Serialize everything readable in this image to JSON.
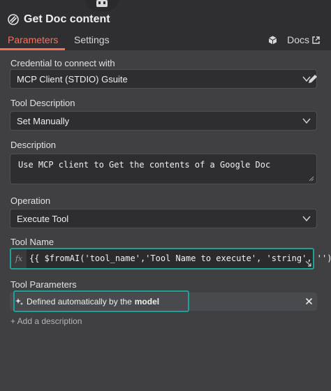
{
  "header": {
    "title": "Get Doc content"
  },
  "tabs": {
    "parameters": "Parameters",
    "settings": "Settings",
    "docs": "Docs"
  },
  "credential": {
    "label": "Credential to connect with",
    "value": "MCP Client (STDIO) Gsuite"
  },
  "tool_description": {
    "label": "Tool Description",
    "value": "Set Manually"
  },
  "description": {
    "label": "Description",
    "value": "Use MCP client to Get the contents of a Google Doc"
  },
  "operation": {
    "label": "Operation",
    "value": "Execute Tool"
  },
  "tool_name": {
    "label": "Tool Name",
    "fx": "fx",
    "expression": "{{ $fromAI('tool_name','Tool Name to execute', 'string', '') }}"
  },
  "tool_parameters": {
    "label": "Tool Parameters",
    "prefix": "Defined automatically by the",
    "emphasis": "model"
  },
  "add_description": "+ Add a description",
  "colors": {
    "accent": "#ff6d5a",
    "highlight": "#1fa295",
    "background": "#404042"
  },
  "icons": [
    "robot-icon",
    "node-icon",
    "cube-icon",
    "external-link-icon",
    "chevron-down-icon",
    "pencil-icon",
    "resize-icon",
    "sparkle-icon",
    "close-icon"
  ]
}
